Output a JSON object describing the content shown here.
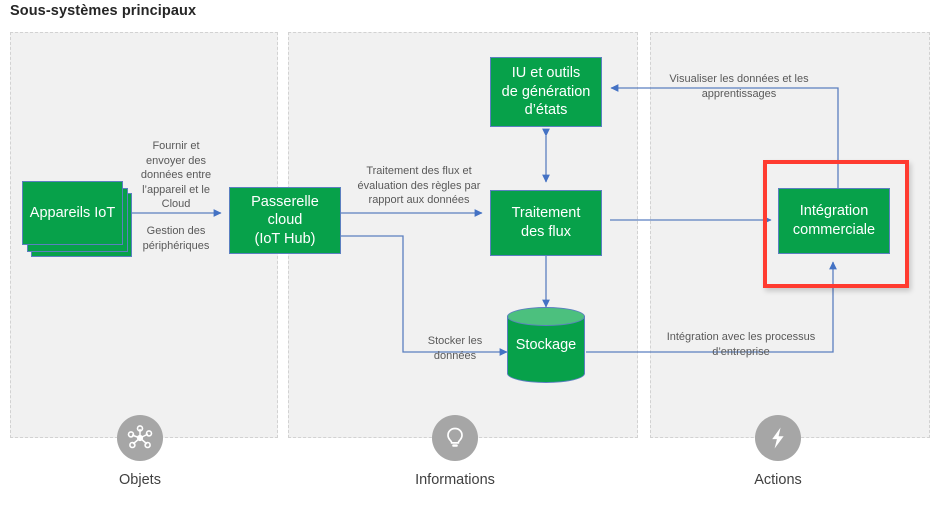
{
  "page": {
    "title": "Sous-systèmes principaux",
    "accent_green": "#07A14A",
    "cylinder_top_green": "#4CC07E",
    "connector_blue": "#5B7FC0",
    "highlight_red": "#FF3B30",
    "zone_background": "#f1f1f1",
    "zone_border": "#d2d2d2",
    "label_gray": "#595959"
  },
  "zones": [
    {
      "id": "objets",
      "name": "zone-objets"
    },
    {
      "id": "informations",
      "name": "zone-informations"
    },
    {
      "id": "actions",
      "name": "zone-actions"
    }
  ],
  "nodes": {
    "devices": {
      "label": "Appareils IoT"
    },
    "gateway": {
      "label": "Passerelle cloud (IoT Hub)",
      "line1": "Passerelle",
      "line2": "cloud",
      "line3": "(IoT Hub)"
    },
    "ui_tools": {
      "label": "IU et outils de génération d’états",
      "line1": "IU et outils",
      "line2": "de génération",
      "line3": "d’états"
    },
    "stream": {
      "label": "Traitement des flux",
      "line1": "Traitement",
      "line2": "des flux"
    },
    "storage": {
      "label": "Stockage"
    },
    "business": {
      "label": "Intégration commerciale",
      "line1": "Intégration",
      "line2": "commerciale"
    }
  },
  "connectors": [
    {
      "id": "devices_gateway_top",
      "label": "Fournir et envoyer des données entre l’appareil et le Cloud"
    },
    {
      "id": "devices_gateway_bot",
      "label": "Gestion des périphériques"
    },
    {
      "id": "gateway_stream",
      "label": "Traitement des flux et évaluation des règles par rapport aux données"
    },
    {
      "id": "gateway_storage",
      "label": "Stocker les données"
    },
    {
      "id": "storage_business",
      "label": "Intégration avec les processus d’entreprise"
    },
    {
      "id": "business_ui",
      "label": "Visualiser les données et les apprentissages"
    }
  ],
  "categories": [
    {
      "id": "objets",
      "label": "Objets",
      "icon": "network-hub-icon"
    },
    {
      "id": "informations",
      "label": "Informations",
      "icon": "lightbulb-icon"
    },
    {
      "id": "actions",
      "label": "Actions",
      "icon": "lightning-bolt-icon"
    }
  ]
}
